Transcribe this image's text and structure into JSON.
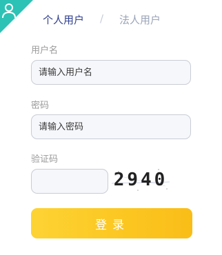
{
  "tabs": {
    "personal": "个人用户",
    "separator": "/",
    "legal": "法人用户",
    "active": "personal"
  },
  "username": {
    "label": "用户名",
    "placeholder": "请输入用户名",
    "value": ""
  },
  "password": {
    "label": "密码",
    "placeholder": "请输入密码",
    "value": ""
  },
  "captcha": {
    "label": "验证码",
    "value": "",
    "image_text": "2940"
  },
  "login_button": {
    "label": "登录"
  },
  "icons": {
    "corner_badge": "user-icon"
  },
  "colors": {
    "accent_teal": "#2cc2b5",
    "button_yellow": "#fcc722",
    "active_tab": "#2f3f8f",
    "inactive_tab": "#9aa4b8"
  }
}
